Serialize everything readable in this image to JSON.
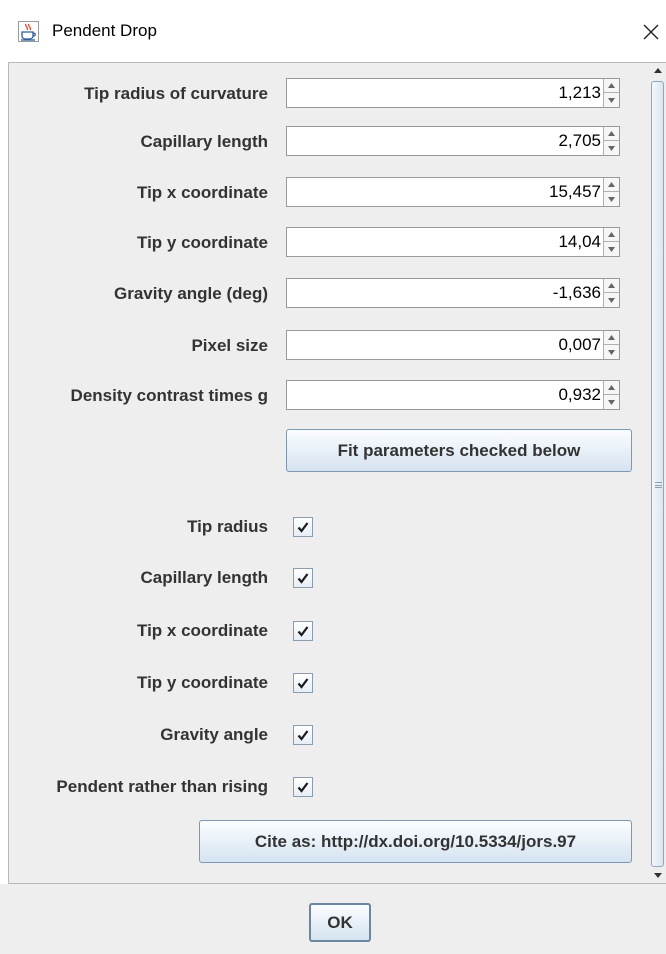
{
  "window": {
    "title": "Pendent Drop",
    "app_icon": "java-cup-icon",
    "close_icon": "close-icon"
  },
  "fields": [
    {
      "label": "Tip radius of curvature",
      "value": "1,213"
    },
    {
      "label": "Capillary length",
      "value": "2,705"
    },
    {
      "label": "Tip x coordinate",
      "value": "15,457"
    },
    {
      "label": "Tip y coordinate",
      "value": "14,04"
    },
    {
      "label": "Gravity angle (deg)",
      "value": "-1,636"
    },
    {
      "label": "Pixel size",
      "value": "0,007"
    },
    {
      "label": "Density contrast times g",
      "value": "0,932"
    }
  ],
  "fit_button": {
    "label": "Fit parameters checked below"
  },
  "checkboxes": [
    {
      "label": "Tip radius",
      "checked": true
    },
    {
      "label": "Capillary length",
      "checked": true
    },
    {
      "label": "Tip x coordinate",
      "checked": true
    },
    {
      "label": "Tip y coordinate",
      "checked": true
    },
    {
      "label": "Gravity angle",
      "checked": true
    },
    {
      "label": "Pendent rather than rising",
      "checked": true
    }
  ],
  "cite_button": {
    "label": "Cite as: http://dx.doi.org/10.5334/jors.97"
  },
  "ok_button": {
    "label": "OK"
  },
  "colors": {
    "button_border": "#7d98b3",
    "label_text": "#333333",
    "panel_bg": "#eeeeee"
  }
}
